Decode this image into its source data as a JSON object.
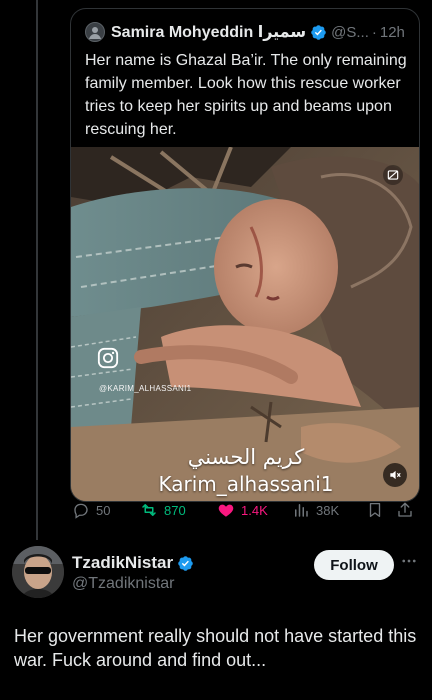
{
  "quoted_post": {
    "author_name": "Samira Mohyeddin سميرا",
    "handle": "@S...",
    "separator": "·",
    "time": "12h",
    "text": "Her name is Ghazal Ba’ir. The only remaining family member. Look how this rescue worker tries to keep her spirits up and beams upon rescuing her.",
    "media": {
      "watermark_handle": "@KARIM_ALHASSANI1",
      "caption_arabic": "كريم الحسني",
      "caption_latin": "Karim_alhassani1",
      "icons": [
        "instagram-icon",
        "sensitive-media-icon",
        "mute-icon"
      ]
    }
  },
  "actions": {
    "replies": "50",
    "reposts": "870",
    "likes": "1.4K",
    "views": "38K",
    "repost_color": "#00ba7c",
    "like_color": "#f91880",
    "icons": [
      "reply-icon",
      "repost-icon",
      "like-icon",
      "views-icon",
      "bookmark-icon",
      "share-icon"
    ]
  },
  "reply_post": {
    "author_name": "TzadikNistar",
    "handle": "@Tzadiknistar",
    "follow_label": "Follow",
    "text": "Her government really should not have started this war. Fuck around and find out..."
  },
  "colors": {
    "background": "#000000",
    "text_primary": "#e7e9ea",
    "text_secondary": "#71767b",
    "verified_blue": "#1d9bf0",
    "border": "#2f3336"
  }
}
